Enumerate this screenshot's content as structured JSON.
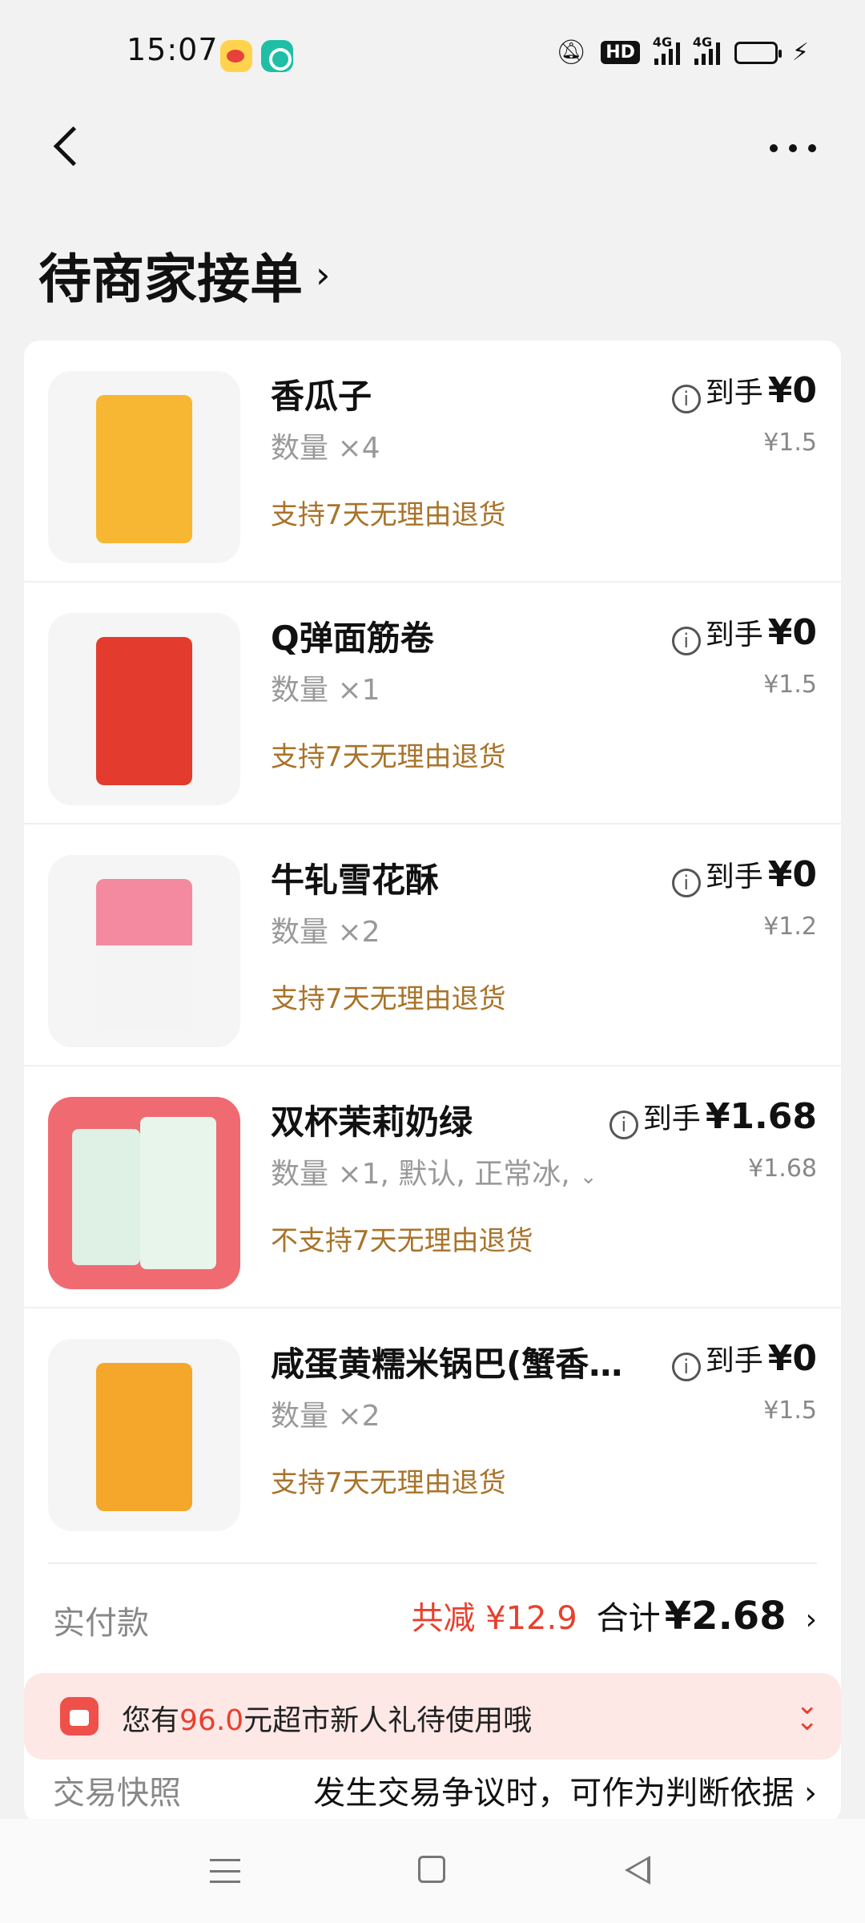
{
  "status_bar": {
    "time": "15:07",
    "icons": [
      "weibo-icon",
      "chat-icon",
      "mute-bell-icon",
      "hd-icon",
      "signal-icon",
      "signal-icon",
      "battery-icon",
      "charging-icon"
    ],
    "hd": "HD",
    "net1": "4G",
    "net2": "4G"
  },
  "header": {
    "back_icon": "chevron-left-icon",
    "more_icon": "more-icon",
    "order_status": "待商家接单",
    "order_status_chevron": "›"
  },
  "items": [
    {
      "title": "香瓜子",
      "qty": "数量 ×4",
      "policy": "支持7天无理由退货",
      "price_label": "到手",
      "price": "¥0",
      "orig_price": "¥1.5",
      "thumb_color": "#f7b733"
    },
    {
      "title": "Q弹面筋卷",
      "qty": "数量 ×1",
      "policy": "支持7天无理由退货",
      "price_label": "到手",
      "price": "¥0",
      "orig_price": "¥1.5",
      "thumb_color": "#e33b2e"
    },
    {
      "title": "牛轧雪花酥",
      "qty": "数量 ×2",
      "policy": "支持7天无理由退货",
      "price_label": "到手",
      "price": "¥0",
      "orig_price": "¥1.2",
      "thumb_color": "#f48aa0"
    },
    {
      "title": "双杯茉莉奶绿",
      "qty": "数量 ×1, 默认, 正常冰,",
      "policy": "不支持7天无理由退货",
      "price_label": "到手",
      "price": "¥1.68",
      "orig_price": "¥1.68",
      "thumb_color": "#f06a72"
    },
    {
      "title": "咸蛋黄糯米锅巴(蟹香咸…",
      "qty": "数量 ×2",
      "policy": "支持7天无理由退货",
      "price_label": "到手",
      "price": "¥0",
      "orig_price": "¥1.5",
      "thumb_color": "#f4a72a"
    }
  ],
  "summary": {
    "paid_label": "实付款",
    "discount": "共减 ¥12.9",
    "total_label": "合计",
    "total": "¥2.68",
    "chevron": "›"
  },
  "snapshot": {
    "label": "交易快照",
    "text": "发生交易争议时，可作为判断依据 ›"
  },
  "promo": {
    "prefix": "您有",
    "amount": "96.0",
    "suffix": "元超市新人礼待使用哦",
    "collapse_icon": "double-chevron-down-icon"
  },
  "colors": {
    "accent_red": "#e8402e",
    "policy_gold": "#a9732a",
    "promo_bg": "#fde8e6"
  }
}
